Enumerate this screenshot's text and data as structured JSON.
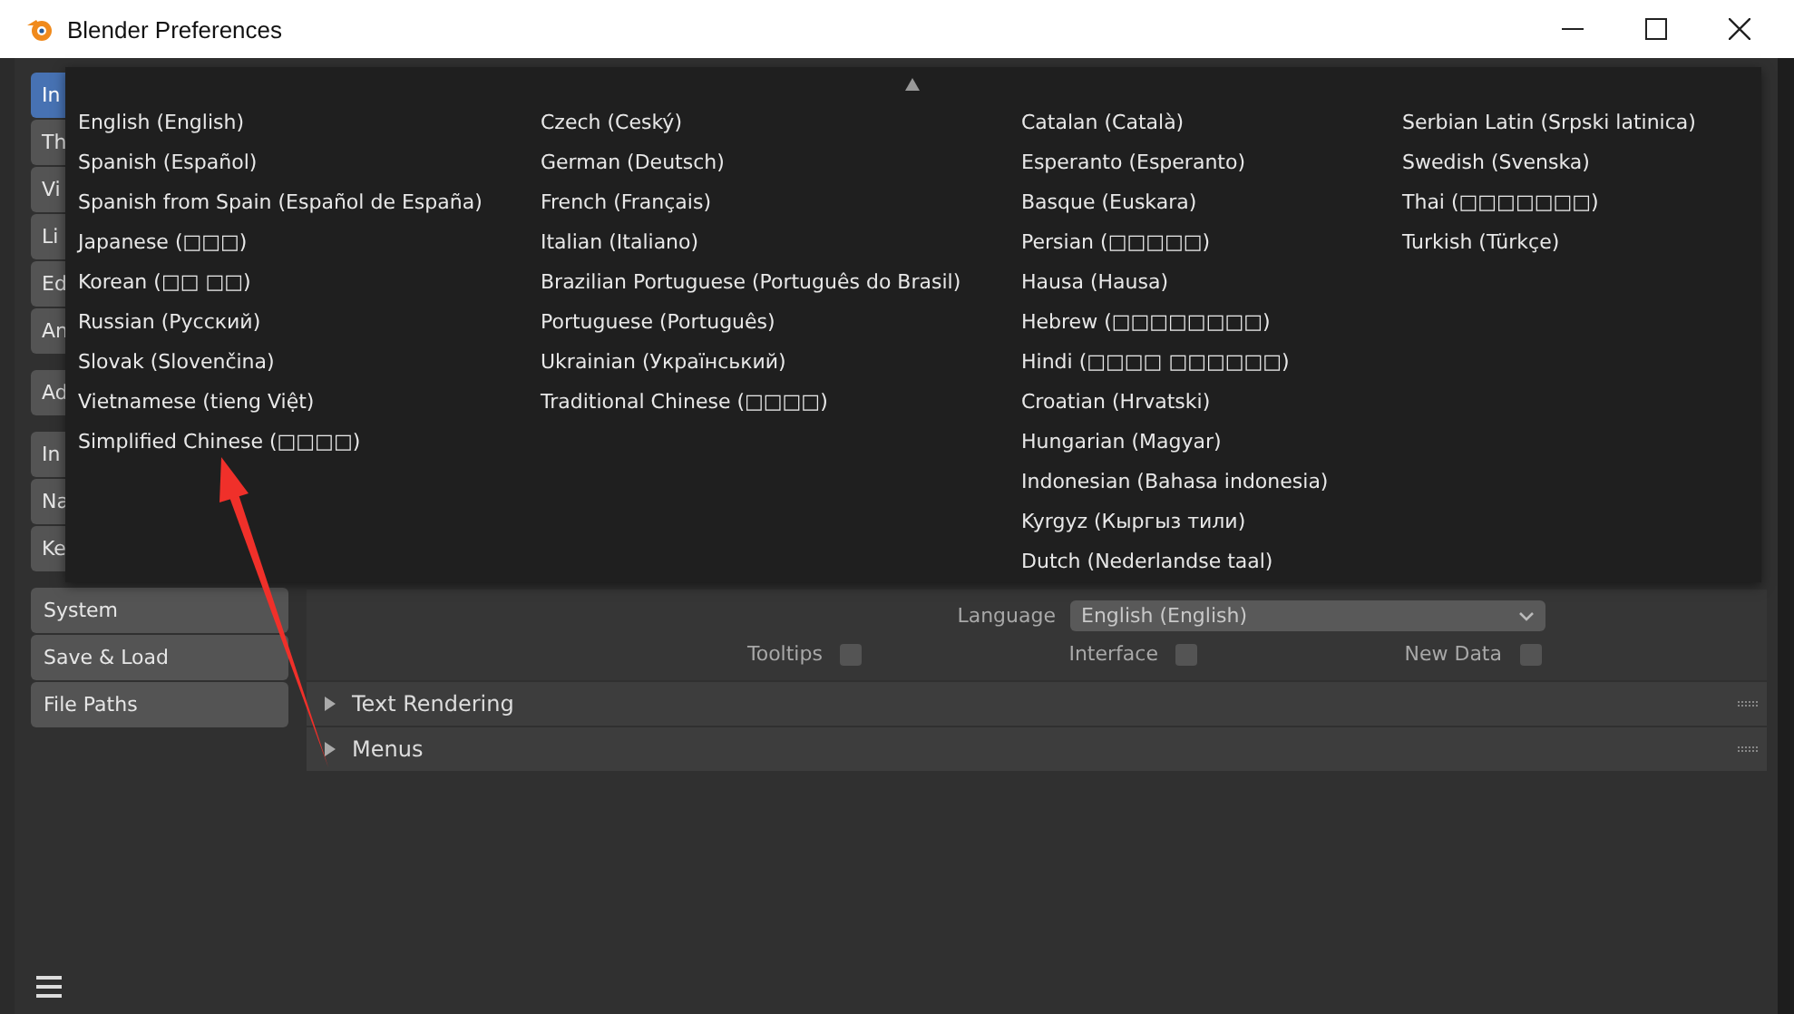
{
  "window": {
    "title": "Blender Preferences"
  },
  "sidebar": {
    "groups": [
      [
        {
          "label": "In",
          "selected": true
        },
        {
          "label": "Th",
          "selected": false
        },
        {
          "label": "Vi",
          "selected": false
        },
        {
          "label": "Li",
          "selected": false
        },
        {
          "label": "Ed",
          "selected": false
        },
        {
          "label": "An",
          "selected": false
        }
      ],
      [
        {
          "label": "Ad",
          "selected": false
        }
      ],
      [
        {
          "label": "In",
          "selected": false
        },
        {
          "label": "Na",
          "selected": false
        },
        {
          "label": "Ke",
          "selected": false
        }
      ],
      [
        {
          "label": "System",
          "selected": false
        },
        {
          "label": "Save & Load",
          "selected": false
        },
        {
          "label": "File Paths",
          "selected": false
        }
      ]
    ]
  },
  "language_menu": {
    "columns": [
      [
        "English (English)",
        "Spanish (Español)",
        "Spanish from Spain (Español de España)",
        "Japanese (□□□)",
        "Korean (□□ □□)",
        "Russian (Русский)",
        "Slovak (Slovenčina)",
        "Vietnamese (tieng Việt)",
        "Simplified Chinese (□□□□)"
      ],
      [
        "Czech (Ceský)",
        "German (Deutsch)",
        "French (Français)",
        "Italian (Italiano)",
        "Brazilian Portuguese (Português do Brasil)",
        "Portuguese (Português)",
        "Ukrainian (Український)",
        "Traditional Chinese (□□□□)"
      ],
      [
        "Catalan (Català)",
        "Esperanto (Esperanto)",
        "Basque (Euskara)",
        "Persian (□□□□□)",
        "Hausa (Hausa)",
        "Hebrew (□□□□□□□□)",
        "Hindi (□□□□ □□□□□□)",
        "Croatian (Hrvatski)",
        "Hungarian (Magyar)",
        "Indonesian (Bahasa indonesia)",
        "Kyrgyz (Кыргыз тили)",
        "Dutch (Nederlandse taal)"
      ],
      [
        "Serbian Latin (Srpski latinica)",
        "Swedish (Svenska)",
        "Thai (□□□□□□□)",
        "Turkish (Türkçe)"
      ]
    ]
  },
  "translation": {
    "language_label": "Language",
    "language_value": "English (English)",
    "checkboxes": [
      {
        "label": "Tooltips",
        "checked": false
      },
      {
        "label": "Interface",
        "checked": false
      },
      {
        "label": "New Data",
        "checked": false
      }
    ]
  },
  "panels": [
    {
      "title": "Text Rendering",
      "expanded": false
    },
    {
      "title": "Menus",
      "expanded": false
    }
  ]
}
